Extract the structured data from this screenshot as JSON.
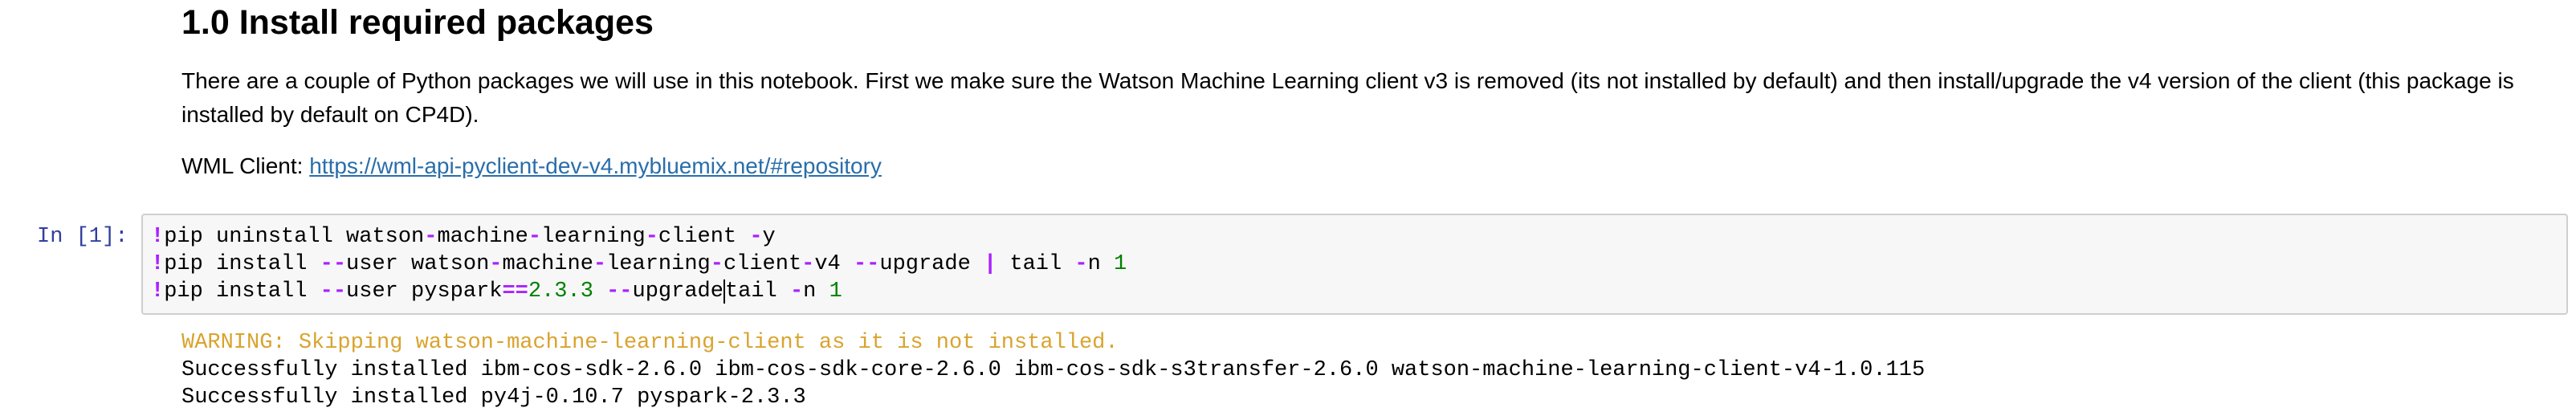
{
  "markdown": {
    "title": "1.0 Install required packages",
    "paragraph": "There are a couple of Python packages we will use in this notebook. First we make sure the Watson Machine Learning client v3 is removed (its not installed by default) and then install/upgrade the v4 version of the client (this package is installed by default on CP4D).",
    "client_label": "WML Client:",
    "client_link": "https://wml-api-pyclient-dev-v4.mybluemix.net/#repository"
  },
  "cell": {
    "prompt": "In [1]:",
    "code": {
      "line1": {
        "bang": "!",
        "cmd": "pip uninstall watson",
        "dash1": "-",
        "mid1": "machine",
        "dash2": "-",
        "mid2": "learning",
        "dash3": "-",
        "end": "client ",
        "flag": "-",
        "flag_end": "y"
      },
      "line2": {
        "bang": "!",
        "cmd": "pip install ",
        "flag1": "--",
        "user": "user watson",
        "dash1": "-",
        "mid1": "machine",
        "dash2": "-",
        "mid2": "learning",
        "dash3": "-",
        "mid3": "client",
        "dash4": "-",
        "v4": "v4 ",
        "flag2": "--",
        "upgrade": "upgrade ",
        "pipe": "|",
        "tail": " tail ",
        "flag3": "-",
        "n": "n ",
        "num": "1"
      },
      "line3": {
        "bang": "!",
        "cmd": "pip install ",
        "flag1": "--",
        "user": "user pyspark",
        "eq": "==",
        "ver": "2.3.3",
        "space": " ",
        "flag2": "--",
        "upgrade": "upgrade",
        "tail": "tail ",
        "flag3": "-",
        "n": "n ",
        "num": "1"
      }
    }
  },
  "output": {
    "warning": "WARNING: Skipping watson-machine-learning-client as it is not installed.",
    "line1": "Successfully installed ibm-cos-sdk-2.6.0 ibm-cos-sdk-core-2.6.0 ibm-cos-sdk-s3transfer-2.6.0 watson-machine-learning-client-v4-1.0.115",
    "line2": "Successfully installed py4j-0.10.7 pyspark-2.3.3"
  },
  "colors": {
    "prompt": "#303f9f",
    "operator": "#aa22ff",
    "number": "#008000",
    "warning": "#d9a32e",
    "link": "#296eaa",
    "cell_bg": "#f7f7f7",
    "cell_border": "#cfcfcf"
  }
}
